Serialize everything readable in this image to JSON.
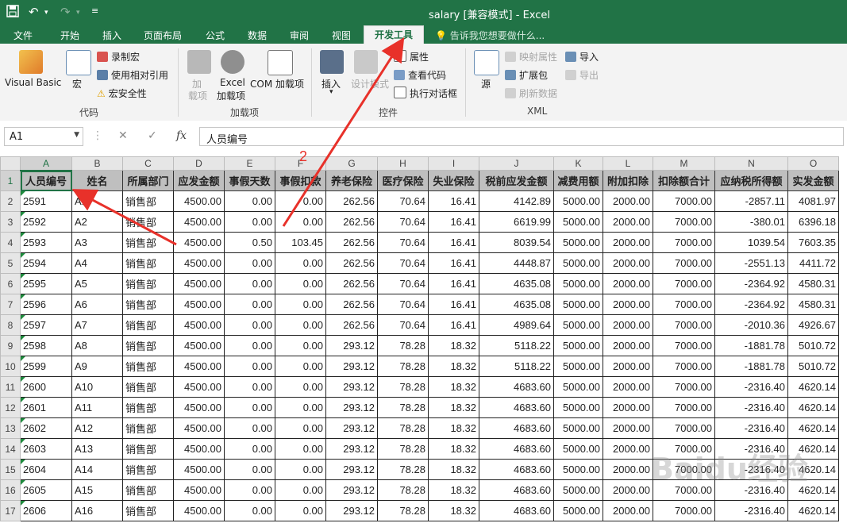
{
  "window": {
    "title": "salary  [兼容模式] - Excel"
  },
  "quick_access": {
    "save_icon": "save-icon",
    "undo_icon": "undo-icon",
    "redo_icon": "redo-icon",
    "customize_icon": "customize-icon"
  },
  "tabs": [
    "文件",
    "开始",
    "插入",
    "页面布局",
    "公式",
    "数据",
    "审阅",
    "视图",
    "开发工具"
  ],
  "active_tab": "开发工具",
  "tell_me": "告诉我您想要做什么...",
  "ribbon": {
    "code": {
      "label": "代码",
      "visual_basic": "Visual Basic",
      "macros": "宏",
      "record_macro": "录制宏",
      "relative_ref": "使用相对引用",
      "macro_security": "宏安全性"
    },
    "addins": {
      "label": "加载项",
      "addins_btn": [
        "加",
        "载项"
      ],
      "excel_addins": [
        "Excel",
        "加载项"
      ],
      "com_addins": [
        "COM 加载项"
      ]
    },
    "controls": {
      "label": "控件",
      "insert": "插入",
      "design_mode": [
        "设计模式"
      ],
      "properties": "属性",
      "view_code": "查看代码",
      "run_dialog": "执行对话框"
    },
    "xml": {
      "label": "XML",
      "source": "源",
      "map_props": "映射属性",
      "expansion": "扩展包",
      "refresh": "刷新数据",
      "import": "导入",
      "export": "导出"
    }
  },
  "formula_bar": {
    "name_box": "A1",
    "fx": "fx",
    "cancel": "✕",
    "enter": "✓",
    "value": "人员编号"
  },
  "columns": [
    "A",
    "B",
    "C",
    "D",
    "E",
    "F",
    "G",
    "H",
    "I",
    "J",
    "K",
    "L",
    "M",
    "N",
    "O"
  ],
  "headers": [
    "人员编号",
    "姓名",
    "所属部门",
    "应发金额",
    "事假天数",
    "事假扣款",
    "养老保险",
    "医疗保险",
    "失业保险",
    "税前应发金额",
    "减费用额",
    "附加扣除",
    "扣除额合计",
    "应纳税所得额",
    "实发金额"
  ],
  "rows": [
    [
      "2591",
      "A1",
      "销售部",
      "4500.00",
      "0.00",
      "0.00",
      "262.56",
      "70.64",
      "16.41",
      "4142.89",
      "5000.00",
      "2000.00",
      "7000.00",
      "-2857.11",
      "4081.97"
    ],
    [
      "2592",
      "A2",
      "销售部",
      "4500.00",
      "0.00",
      "0.00",
      "262.56",
      "70.64",
      "16.41",
      "6619.99",
      "5000.00",
      "2000.00",
      "7000.00",
      "-380.01",
      "6396.18"
    ],
    [
      "2593",
      "A3",
      "销售部",
      "4500.00",
      "0.50",
      "103.45",
      "262.56",
      "70.64",
      "16.41",
      "8039.54",
      "5000.00",
      "2000.00",
      "7000.00",
      "1039.54",
      "7603.35"
    ],
    [
      "2594",
      "A4",
      "销售部",
      "4500.00",
      "0.00",
      "0.00",
      "262.56",
      "70.64",
      "16.41",
      "4448.87",
      "5000.00",
      "2000.00",
      "7000.00",
      "-2551.13",
      "4411.72"
    ],
    [
      "2595",
      "A5",
      "销售部",
      "4500.00",
      "0.00",
      "0.00",
      "262.56",
      "70.64",
      "16.41",
      "4635.08",
      "5000.00",
      "2000.00",
      "7000.00",
      "-2364.92",
      "4580.31"
    ],
    [
      "2596",
      "A6",
      "销售部",
      "4500.00",
      "0.00",
      "0.00",
      "262.56",
      "70.64",
      "16.41",
      "4635.08",
      "5000.00",
      "2000.00",
      "7000.00",
      "-2364.92",
      "4580.31"
    ],
    [
      "2597",
      "A7",
      "销售部",
      "4500.00",
      "0.00",
      "0.00",
      "262.56",
      "70.64",
      "16.41",
      "4989.64",
      "5000.00",
      "2000.00",
      "7000.00",
      "-2010.36",
      "4926.67"
    ],
    [
      "2598",
      "A8",
      "销售部",
      "4500.00",
      "0.00",
      "0.00",
      "293.12",
      "78.28",
      "18.32",
      "5118.22",
      "5000.00",
      "2000.00",
      "7000.00",
      "-1881.78",
      "5010.72"
    ],
    [
      "2599",
      "A9",
      "销售部",
      "4500.00",
      "0.00",
      "0.00",
      "293.12",
      "78.28",
      "18.32",
      "5118.22",
      "5000.00",
      "2000.00",
      "7000.00",
      "-1881.78",
      "5010.72"
    ],
    [
      "2600",
      "A10",
      "销售部",
      "4500.00",
      "0.00",
      "0.00",
      "293.12",
      "78.28",
      "18.32",
      "4683.60",
      "5000.00",
      "2000.00",
      "7000.00",
      "-2316.40",
      "4620.14"
    ],
    [
      "2601",
      "A11",
      "销售部",
      "4500.00",
      "0.00",
      "0.00",
      "293.12",
      "78.28",
      "18.32",
      "4683.60",
      "5000.00",
      "2000.00",
      "7000.00",
      "-2316.40",
      "4620.14"
    ],
    [
      "2602",
      "A12",
      "销售部",
      "4500.00",
      "0.00",
      "0.00",
      "293.12",
      "78.28",
      "18.32",
      "4683.60",
      "5000.00",
      "2000.00",
      "7000.00",
      "-2316.40",
      "4620.14"
    ],
    [
      "2603",
      "A13",
      "销售部",
      "4500.00",
      "0.00",
      "0.00",
      "293.12",
      "78.28",
      "18.32",
      "4683.60",
      "5000.00",
      "2000.00",
      "7000.00",
      "-2316.40",
      "4620.14"
    ],
    [
      "2604",
      "A14",
      "销售部",
      "4500.00",
      "0.00",
      "0.00",
      "293.12",
      "78.28",
      "18.32",
      "4683.60",
      "5000.00",
      "2000.00",
      "7000.00",
      "-2316.40",
      "4620.14"
    ],
    [
      "2605",
      "A15",
      "销售部",
      "4500.00",
      "0.00",
      "0.00",
      "293.12",
      "78.28",
      "18.32",
      "4683.60",
      "5000.00",
      "2000.00",
      "7000.00",
      "-2316.40",
      "4620.14"
    ],
    [
      "2606",
      "A16",
      "销售部",
      "4500.00",
      "0.00",
      "0.00",
      "293.12",
      "78.28",
      "18.32",
      "4683.60",
      "5000.00",
      "2000.00",
      "7000.00",
      "-2316.40",
      "4620.14"
    ]
  ],
  "annotation": {
    "step_label": "2",
    "color": "#e8312a"
  },
  "watermark": "Baidu经验",
  "colors": {
    "excel_green": "#217346",
    "header_fill": "#bfbfbf"
  }
}
